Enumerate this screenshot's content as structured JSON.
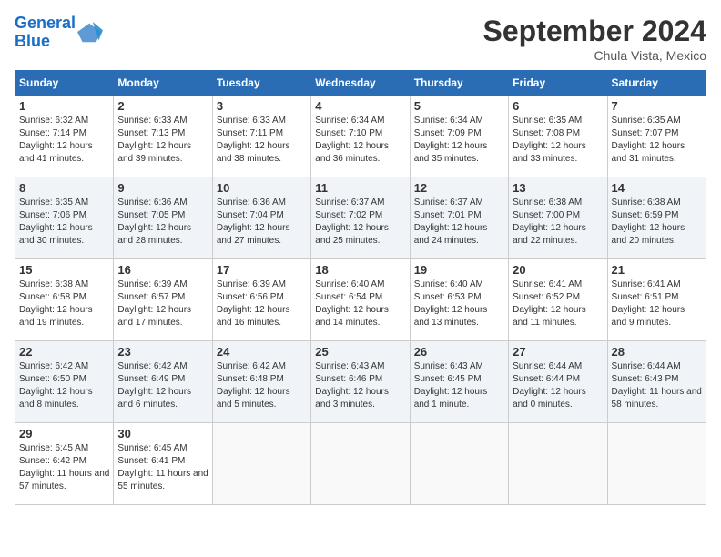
{
  "header": {
    "logo_line1": "General",
    "logo_line2": "Blue",
    "month_title": "September 2024",
    "location": "Chula Vista, Mexico"
  },
  "weekdays": [
    "Sunday",
    "Monday",
    "Tuesday",
    "Wednesday",
    "Thursday",
    "Friday",
    "Saturday"
  ],
  "weeks": [
    [
      {
        "day": "1",
        "sunrise": "Sunrise: 6:32 AM",
        "sunset": "Sunset: 7:14 PM",
        "daylight": "Daylight: 12 hours and 41 minutes."
      },
      {
        "day": "2",
        "sunrise": "Sunrise: 6:33 AM",
        "sunset": "Sunset: 7:13 PM",
        "daylight": "Daylight: 12 hours and 39 minutes."
      },
      {
        "day": "3",
        "sunrise": "Sunrise: 6:33 AM",
        "sunset": "Sunset: 7:11 PM",
        "daylight": "Daylight: 12 hours and 38 minutes."
      },
      {
        "day": "4",
        "sunrise": "Sunrise: 6:34 AM",
        "sunset": "Sunset: 7:10 PM",
        "daylight": "Daylight: 12 hours and 36 minutes."
      },
      {
        "day": "5",
        "sunrise": "Sunrise: 6:34 AM",
        "sunset": "Sunset: 7:09 PM",
        "daylight": "Daylight: 12 hours and 35 minutes."
      },
      {
        "day": "6",
        "sunrise": "Sunrise: 6:35 AM",
        "sunset": "Sunset: 7:08 PM",
        "daylight": "Daylight: 12 hours and 33 minutes."
      },
      {
        "day": "7",
        "sunrise": "Sunrise: 6:35 AM",
        "sunset": "Sunset: 7:07 PM",
        "daylight": "Daylight: 12 hours and 31 minutes."
      }
    ],
    [
      {
        "day": "8",
        "sunrise": "Sunrise: 6:35 AM",
        "sunset": "Sunset: 7:06 PM",
        "daylight": "Daylight: 12 hours and 30 minutes."
      },
      {
        "day": "9",
        "sunrise": "Sunrise: 6:36 AM",
        "sunset": "Sunset: 7:05 PM",
        "daylight": "Daylight: 12 hours and 28 minutes."
      },
      {
        "day": "10",
        "sunrise": "Sunrise: 6:36 AM",
        "sunset": "Sunset: 7:04 PM",
        "daylight": "Daylight: 12 hours and 27 minutes."
      },
      {
        "day": "11",
        "sunrise": "Sunrise: 6:37 AM",
        "sunset": "Sunset: 7:02 PM",
        "daylight": "Daylight: 12 hours and 25 minutes."
      },
      {
        "day": "12",
        "sunrise": "Sunrise: 6:37 AM",
        "sunset": "Sunset: 7:01 PM",
        "daylight": "Daylight: 12 hours and 24 minutes."
      },
      {
        "day": "13",
        "sunrise": "Sunrise: 6:38 AM",
        "sunset": "Sunset: 7:00 PM",
        "daylight": "Daylight: 12 hours and 22 minutes."
      },
      {
        "day": "14",
        "sunrise": "Sunrise: 6:38 AM",
        "sunset": "Sunset: 6:59 PM",
        "daylight": "Daylight: 12 hours and 20 minutes."
      }
    ],
    [
      {
        "day": "15",
        "sunrise": "Sunrise: 6:38 AM",
        "sunset": "Sunset: 6:58 PM",
        "daylight": "Daylight: 12 hours and 19 minutes."
      },
      {
        "day": "16",
        "sunrise": "Sunrise: 6:39 AM",
        "sunset": "Sunset: 6:57 PM",
        "daylight": "Daylight: 12 hours and 17 minutes."
      },
      {
        "day": "17",
        "sunrise": "Sunrise: 6:39 AM",
        "sunset": "Sunset: 6:56 PM",
        "daylight": "Daylight: 12 hours and 16 minutes."
      },
      {
        "day": "18",
        "sunrise": "Sunrise: 6:40 AM",
        "sunset": "Sunset: 6:54 PM",
        "daylight": "Daylight: 12 hours and 14 minutes."
      },
      {
        "day": "19",
        "sunrise": "Sunrise: 6:40 AM",
        "sunset": "Sunset: 6:53 PM",
        "daylight": "Daylight: 12 hours and 13 minutes."
      },
      {
        "day": "20",
        "sunrise": "Sunrise: 6:41 AM",
        "sunset": "Sunset: 6:52 PM",
        "daylight": "Daylight: 12 hours and 11 minutes."
      },
      {
        "day": "21",
        "sunrise": "Sunrise: 6:41 AM",
        "sunset": "Sunset: 6:51 PM",
        "daylight": "Daylight: 12 hours and 9 minutes."
      }
    ],
    [
      {
        "day": "22",
        "sunrise": "Sunrise: 6:42 AM",
        "sunset": "Sunset: 6:50 PM",
        "daylight": "Daylight: 12 hours and 8 minutes."
      },
      {
        "day": "23",
        "sunrise": "Sunrise: 6:42 AM",
        "sunset": "Sunset: 6:49 PM",
        "daylight": "Daylight: 12 hours and 6 minutes."
      },
      {
        "day": "24",
        "sunrise": "Sunrise: 6:42 AM",
        "sunset": "Sunset: 6:48 PM",
        "daylight": "Daylight: 12 hours and 5 minutes."
      },
      {
        "day": "25",
        "sunrise": "Sunrise: 6:43 AM",
        "sunset": "Sunset: 6:46 PM",
        "daylight": "Daylight: 12 hours and 3 minutes."
      },
      {
        "day": "26",
        "sunrise": "Sunrise: 6:43 AM",
        "sunset": "Sunset: 6:45 PM",
        "daylight": "Daylight: 12 hours and 1 minute."
      },
      {
        "day": "27",
        "sunrise": "Sunrise: 6:44 AM",
        "sunset": "Sunset: 6:44 PM",
        "daylight": "Daylight: 12 hours and 0 minutes."
      },
      {
        "day": "28",
        "sunrise": "Sunrise: 6:44 AM",
        "sunset": "Sunset: 6:43 PM",
        "daylight": "Daylight: 11 hours and 58 minutes."
      }
    ],
    [
      {
        "day": "29",
        "sunrise": "Sunrise: 6:45 AM",
        "sunset": "Sunset: 6:42 PM",
        "daylight": "Daylight: 11 hours and 57 minutes."
      },
      {
        "day": "30",
        "sunrise": "Sunrise: 6:45 AM",
        "sunset": "Sunset: 6:41 PM",
        "daylight": "Daylight: 11 hours and 55 minutes."
      },
      null,
      null,
      null,
      null,
      null
    ]
  ]
}
